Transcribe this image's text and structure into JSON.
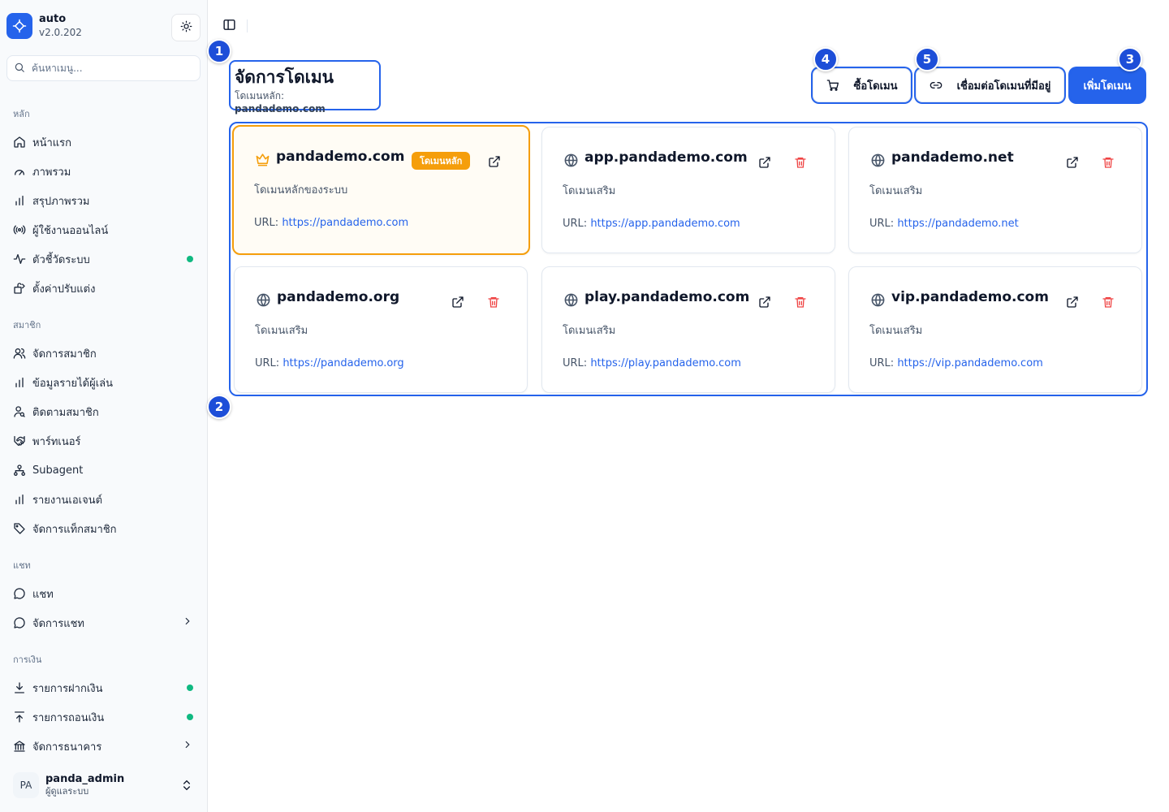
{
  "brand": {
    "name": "auto",
    "version": "v2.0.202"
  },
  "search": {
    "placeholder": "ค้นหาเมนู..."
  },
  "sidebar": {
    "groups": {
      "main": "หลัก",
      "members": "สมาชิก",
      "chat": "แชท",
      "finance": "การเงิน"
    },
    "items": {
      "home": "หน้าแรก",
      "overview": "ภาพรวม",
      "summary": "สรุปภาพรวม",
      "online": "ผู้ใช้งานออนไลน์",
      "metrics": "ตัวชี้วัดระบบ",
      "custom": "ตั้งค่าปรับแต่ง",
      "manage_members": "จัดการสมาชิก",
      "player_income": "ข้อมูลรายได้ผู้เล่น",
      "track_members": "ติดตามสมาชิก",
      "partner": "พาร์ทเนอร์",
      "subagent": "Subagent",
      "agent_report": "รายงานเอเจนต์",
      "member_tags": "จัดการแท็กสมาชิก",
      "chat": "แชท",
      "manage_chat": "จัดการแชท",
      "deposits": "รายการฝากเงิน",
      "withdrawals": "รายการถอนเงิน",
      "banks": "จัดการธนาคาร"
    }
  },
  "user": {
    "initials": "PA",
    "name": "panda_admin",
    "role": "ผู้ดูแลระบบ"
  },
  "page": {
    "title": "จัดการโดเมน",
    "subtitle_label": "โดเมนหลัก:",
    "subtitle_value": "pandademo.com"
  },
  "actions": {
    "buy": "ซื้อโดเมน",
    "connect": "เชื่อมต่อโดเมนที่มีอยู่",
    "add": "เพิ่มโดเมน"
  },
  "url_label": "URL:",
  "domains": [
    {
      "name": "pandademo.com",
      "badge": "โดเมนหลัก",
      "desc": "โดเมนหลักของระบบ",
      "url": "https://pandademo.com",
      "icon": "crown-icon"
    },
    {
      "name": "app.pandademo.com",
      "desc": "โดเมนเสริม",
      "url": "https://app.pandademo.com",
      "icon": "globe-icon"
    },
    {
      "name": "pandademo.net",
      "desc": "โดเมนเสริม",
      "url": "https://pandademo.net",
      "icon": "globe-icon"
    },
    {
      "name": "pandademo.org",
      "desc": "โดเมนเสริม",
      "url": "https://pandademo.org",
      "icon": "globe-icon"
    },
    {
      "name": "play.pandademo.com",
      "desc": "โดเมนเสริม",
      "url": "https://play.pandademo.com",
      "icon": "globe-icon"
    },
    {
      "name": "vip.pandademo.com",
      "desc": "โดเมนเสริม",
      "url": "https://vip.pandademo.com",
      "icon": "globe-icon"
    }
  ],
  "markers": [
    "1",
    "2",
    "3",
    "4",
    "5"
  ],
  "colors": {
    "accent": "#2563eb",
    "primary_domain": "#f59e0b",
    "danger": "#ef4444",
    "status_dot": "#10b981"
  }
}
